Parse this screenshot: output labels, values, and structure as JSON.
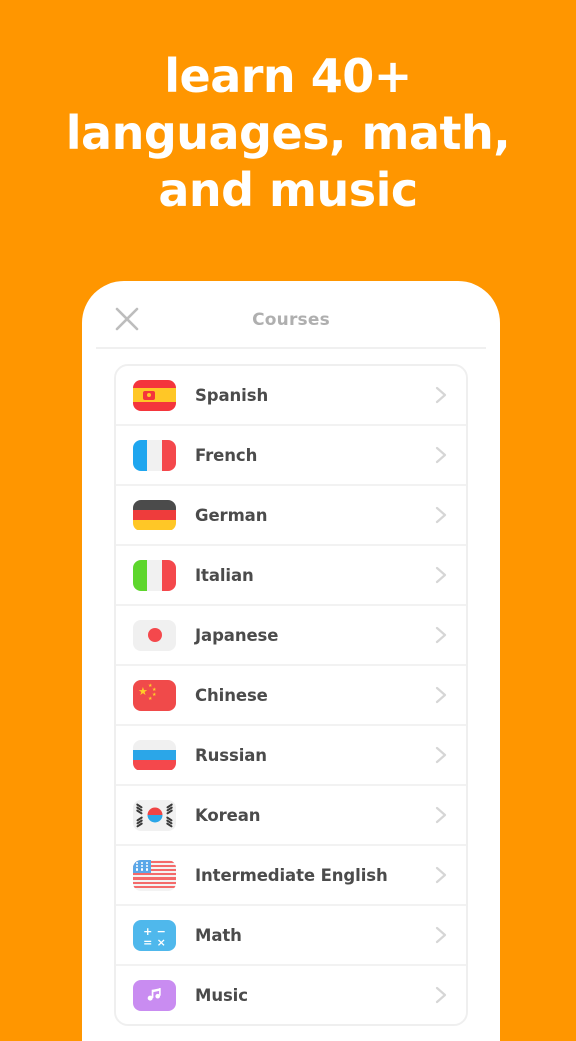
{
  "theme": {
    "background": "#ff9600",
    "headline_color": "#ffffff",
    "row_label_color": "#4b4b4b",
    "nav_title_color": "#afafaf",
    "chevron_color": "#d4d4d4",
    "math_icon_color": "#4fb8ec",
    "music_icon_color": "#c98cf1"
  },
  "headline": {
    "text": "learn 40+\nlanguages, math,\nand music"
  },
  "phone": {
    "navbar": {
      "close_label": "close-icon",
      "title": "Courses"
    },
    "courses": [
      {
        "label": "Spanish",
        "icon": "flag-spain",
        "chevron": "chevron-right-icon"
      },
      {
        "label": "French",
        "icon": "flag-france",
        "chevron": "chevron-right-icon"
      },
      {
        "label": "German",
        "icon": "flag-germany",
        "chevron": "chevron-right-icon"
      },
      {
        "label": "Italian",
        "icon": "flag-italy",
        "chevron": "chevron-right-icon"
      },
      {
        "label": "Japanese",
        "icon": "flag-japan",
        "chevron": "chevron-right-icon"
      },
      {
        "label": "Chinese",
        "icon": "flag-china",
        "chevron": "chevron-right-icon"
      },
      {
        "label": "Russian",
        "icon": "flag-russia",
        "chevron": "chevron-right-icon"
      },
      {
        "label": "Korean",
        "icon": "flag-korea",
        "chevron": "chevron-right-icon"
      },
      {
        "label": "Intermediate English",
        "icon": "flag-usa",
        "chevron": "chevron-right-icon"
      },
      {
        "label": "Math",
        "icon": "math-icon",
        "chevron": "chevron-right-icon"
      },
      {
        "label": "Music",
        "icon": "music-icon",
        "chevron": "chevron-right-icon"
      }
    ],
    "math_symbols": [
      "+",
      "−",
      "=",
      "×"
    ]
  }
}
